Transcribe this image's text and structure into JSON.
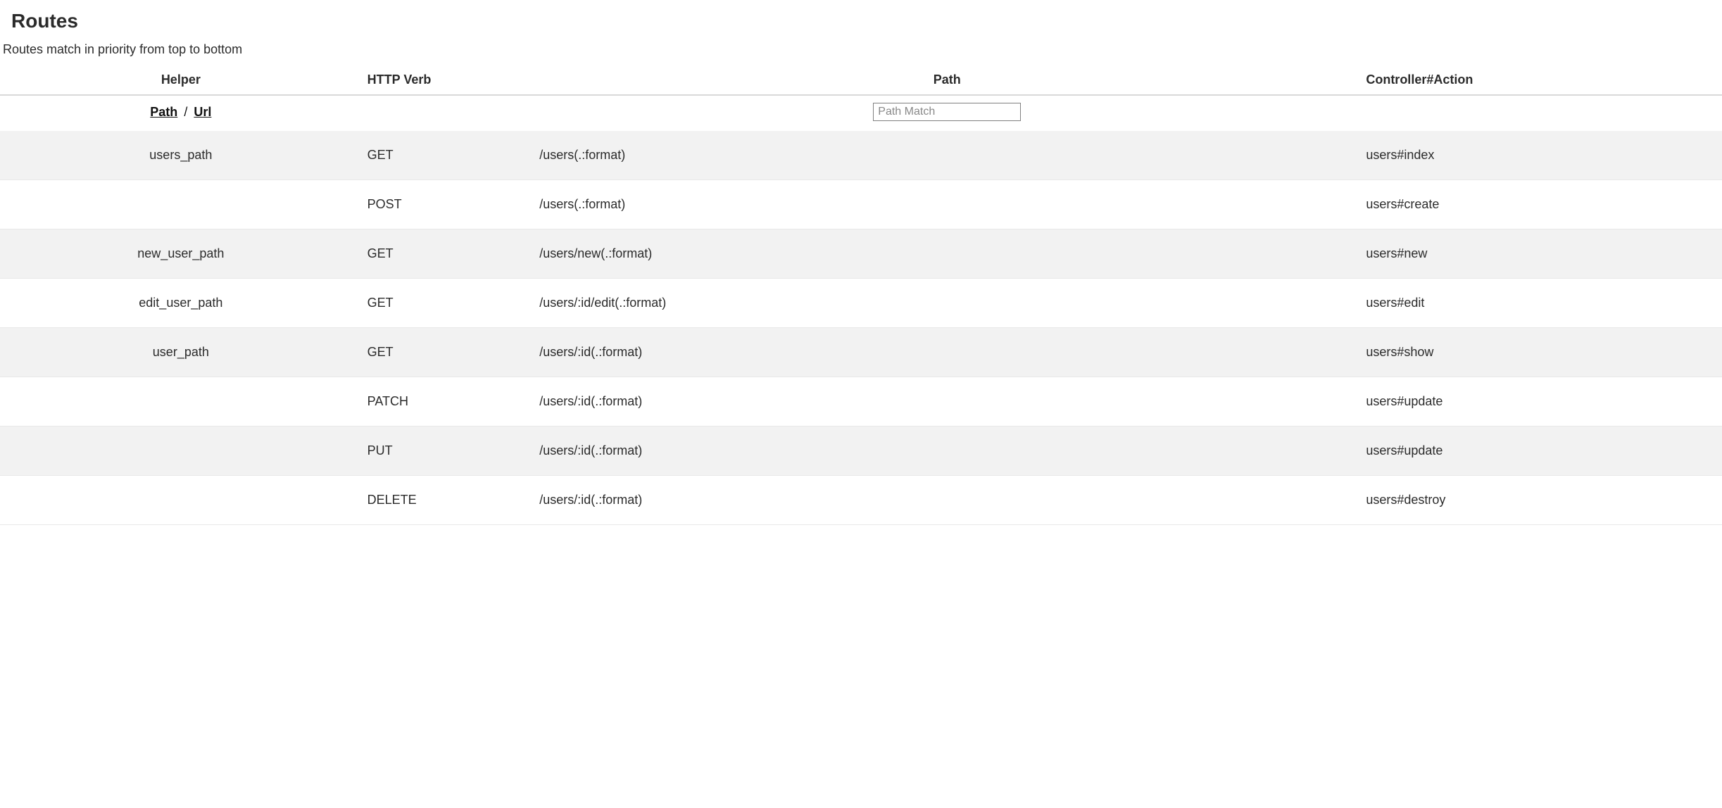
{
  "title": "Routes",
  "subtitle": "Routes match in priority from top to bottom",
  "columns": {
    "helper": "Helper",
    "verb": "HTTP Verb",
    "path": "Path",
    "action": "Controller#Action"
  },
  "helper_toggle": {
    "path_label": "Path",
    "separator": "/",
    "url_label": "Url"
  },
  "filter": {
    "placeholder": "Path Match"
  },
  "routes": [
    {
      "helper": "users_path",
      "verb": "GET",
      "path": "/users(.:format)",
      "action": "users#index"
    },
    {
      "helper": "",
      "verb": "POST",
      "path": "/users(.:format)",
      "action": "users#create"
    },
    {
      "helper": "new_user_path",
      "verb": "GET",
      "path": "/users/new(.:format)",
      "action": "users#new"
    },
    {
      "helper": "edit_user_path",
      "verb": "GET",
      "path": "/users/:id/edit(.:format)",
      "action": "users#edit"
    },
    {
      "helper": "user_path",
      "verb": "GET",
      "path": "/users/:id(.:format)",
      "action": "users#show"
    },
    {
      "helper": "",
      "verb": "PATCH",
      "path": "/users/:id(.:format)",
      "action": "users#update"
    },
    {
      "helper": "",
      "verb": "PUT",
      "path": "/users/:id(.:format)",
      "action": "users#update"
    },
    {
      "helper": "",
      "verb": "DELETE",
      "path": "/users/:id(.:format)",
      "action": "users#destroy"
    }
  ]
}
